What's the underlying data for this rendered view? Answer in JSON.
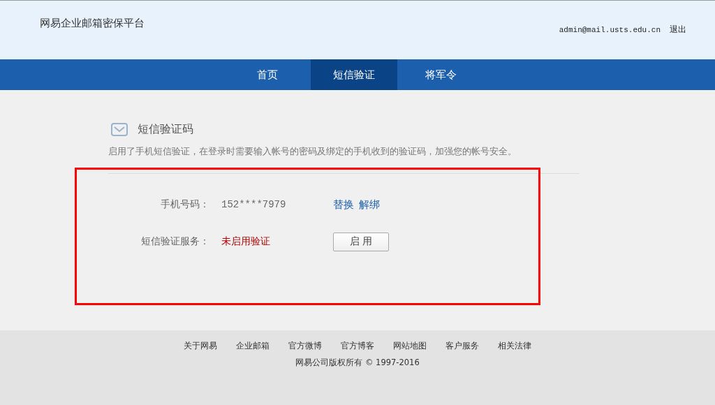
{
  "header": {
    "title": "网易企业邮箱密保平台",
    "account": "admin@mail.usts.edu.cn",
    "logout": "退出"
  },
  "nav": [
    {
      "label": "首页",
      "selected": false
    },
    {
      "label": "短信验证",
      "selected": true
    },
    {
      "label": "将军令",
      "selected": false
    }
  ],
  "section": {
    "title": "短信验证码",
    "description": "启用了手机短信验证，在登录时需要输入帐号的密码及绑定的手机收到的验证码，加强您的帐号安全。"
  },
  "phone": {
    "label": "手机号码：",
    "value": "152****7979",
    "links": [
      "替换",
      "解绑"
    ]
  },
  "service": {
    "label": "短信验证服务：",
    "status": "未启用验证",
    "enabled": false,
    "button": "启 用"
  },
  "footer": {
    "links": [
      "关于网易",
      "企业邮箱",
      "官方微博",
      "官方博客",
      "网站地图",
      "客户服务",
      "相关法律"
    ],
    "copyright": "网易公司版权所有 © 1997-2016"
  }
}
